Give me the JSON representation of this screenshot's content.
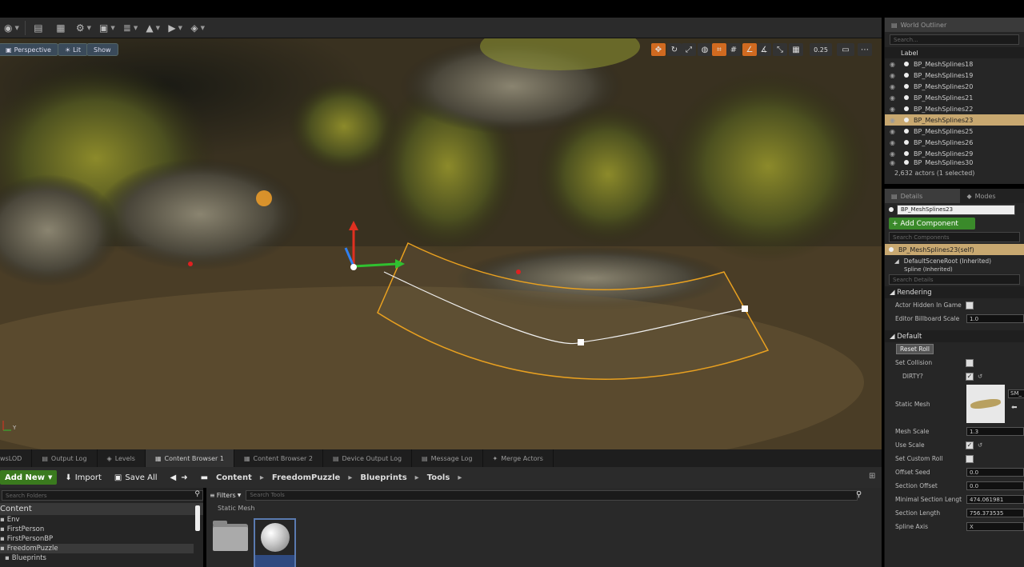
{
  "toolbar": {
    "icons": [
      "blueprint-icon",
      "content-icon",
      "marketplace-icon",
      "settings-icon",
      "build-icon",
      "play-icon",
      "launch-icon"
    ]
  },
  "viewport": {
    "perspective_label": "Perspective",
    "lit_label": "Lit",
    "show_label": "Show",
    "grid_value": "0.25",
    "axis_label": "Y"
  },
  "outliner": {
    "tab_label": "World Outliner",
    "search_placeholder": "Search...",
    "column_label": "Label",
    "rows": [
      {
        "label": "BP_MeshSplines18",
        "selected": false
      },
      {
        "label": "BP_MeshSplines19",
        "selected": false
      },
      {
        "label": "BP_MeshSplines20",
        "selected": false
      },
      {
        "label": "BP_MeshSplines21",
        "selected": false
      },
      {
        "label": "BP_MeshSplines22",
        "selected": false
      },
      {
        "label": "BP_MeshSplines23",
        "selected": true
      },
      {
        "label": "BP_MeshSplines25",
        "selected": false
      },
      {
        "label": "BP_MeshSplines26",
        "selected": false
      },
      {
        "label": "BP_MeshSplines29",
        "selected": false
      },
      {
        "label": "BP_MeshSplines30",
        "selected": false
      }
    ],
    "status": "2,632 actors (1 selected)"
  },
  "details": {
    "tab_details": "Details",
    "tab_modes": "Modes",
    "name_value": "BP_MeshSplines23",
    "add_component": "+ Add Component",
    "search_components": "Search Components",
    "self_label": "BP_MeshSplines23(self)",
    "root_label": "DefaultSceneRoot (Inherited)",
    "spline_label": "Spline (Inherited)",
    "search_details": "Search Details",
    "rendering_header": "Rendering",
    "actor_hidden": "Actor Hidden In Game",
    "billboard_scale_label": "Editor Billboard Scale",
    "billboard_scale_value": "1.0",
    "default_header": "Default",
    "reset_roll": "Reset Roll",
    "set_collision": "Set Collision",
    "dirty": "DIRTY?",
    "static_mesh": "Static Mesh",
    "static_mesh_value": "SM_",
    "mesh_scale_label": "Mesh Scale",
    "mesh_scale_value": "1.3",
    "use_scale": "Use Scale",
    "set_custom_roll": "Set Custom Roll",
    "offset_seed_label": "Offset Seed",
    "offset_seed_value": "0.0",
    "section_offset_label": "Section Offset",
    "section_offset_value": "0.0",
    "min_section_label": "Minimal Section Lengt",
    "min_section_value": "474.061981",
    "section_length_label": "Section Length",
    "section_length_value": "756.373535",
    "spline_axis_label": "Spline Axis",
    "spline_axis_value": "X"
  },
  "bottom_tabs": [
    {
      "label": "wsLOD",
      "active": false
    },
    {
      "label": "Output Log",
      "active": false
    },
    {
      "label": "Levels",
      "active": false
    },
    {
      "label": "Content Browser 1",
      "active": true
    },
    {
      "label": "Content Browser 2",
      "active": false
    },
    {
      "label": "Device Output Log",
      "active": false
    },
    {
      "label": "Message Log",
      "active": false
    },
    {
      "label": "Merge Actors",
      "active": false
    }
  ],
  "content_browser": {
    "add_new": "Add New",
    "import": "Import",
    "save_all": "Save All",
    "breadcrumbs": [
      "Content",
      "FreedomPuzzle",
      "Blueprints",
      "Tools"
    ],
    "search_folders": "Search Folders",
    "filters": "Filters",
    "search_tools": "Search Tools",
    "static_mesh_label": "Static Mesh",
    "tree": [
      {
        "label": "Content",
        "level": 0
      },
      {
        "label": "Env",
        "level": 1
      },
      {
        "label": "FirstPerson",
        "level": 1
      },
      {
        "label": "FirstPersonBP",
        "level": 1
      },
      {
        "label": "FreedomPuzzle",
        "level": 1
      },
      {
        "label": "Blueprints",
        "level": 2
      }
    ]
  }
}
